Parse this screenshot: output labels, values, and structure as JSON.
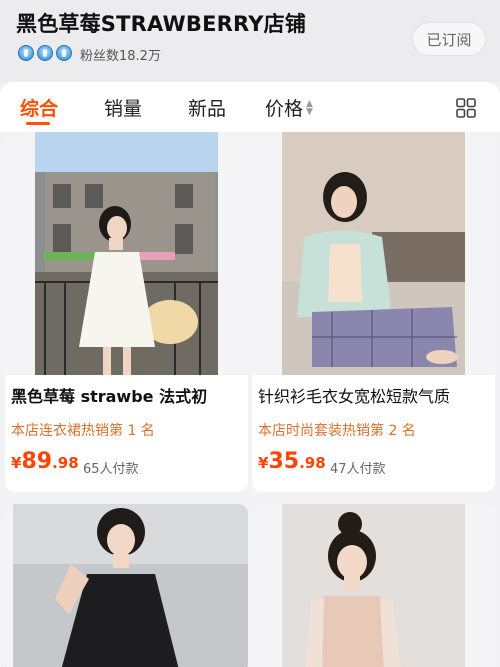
{
  "store": {
    "name": "黑色草莓STRAWBERRY店铺",
    "fans": "粉丝数18.2万",
    "badge_icon": "crown-medal-icon",
    "badge_count": 3,
    "subscribe_label": "已订阅"
  },
  "sort_tabs": [
    {
      "label": "综合",
      "active": true
    },
    {
      "label": "销量",
      "active": false
    },
    {
      "label": "新品",
      "active": false
    },
    {
      "label": "价格",
      "active": false
    }
  ],
  "colors": {
    "accent": "#ff5000",
    "price": "#ff4400",
    "rank": "#d9712e"
  },
  "products": [
    {
      "title": "黑色草莓 strawbe 法式初",
      "rank": "本店连衣裙热销第 1 名",
      "currency": "¥",
      "price_int": "89",
      "price_dec": ".98",
      "sold": "65人付款"
    },
    {
      "title": "针织衫毛衣女宽松短款气质",
      "rank": "本店时尚套装热销第 2 名",
      "currency": "¥",
      "price_int": "35",
      "price_dec": ".98",
      "sold": "47人付款"
    },
    {
      "title": "",
      "rank": "",
      "currency": "",
      "price_int": "",
      "price_dec": "",
      "sold": ""
    },
    {
      "title": "",
      "rank": "",
      "currency": "",
      "price_int": "",
      "price_dec": "",
      "sold": ""
    }
  ]
}
